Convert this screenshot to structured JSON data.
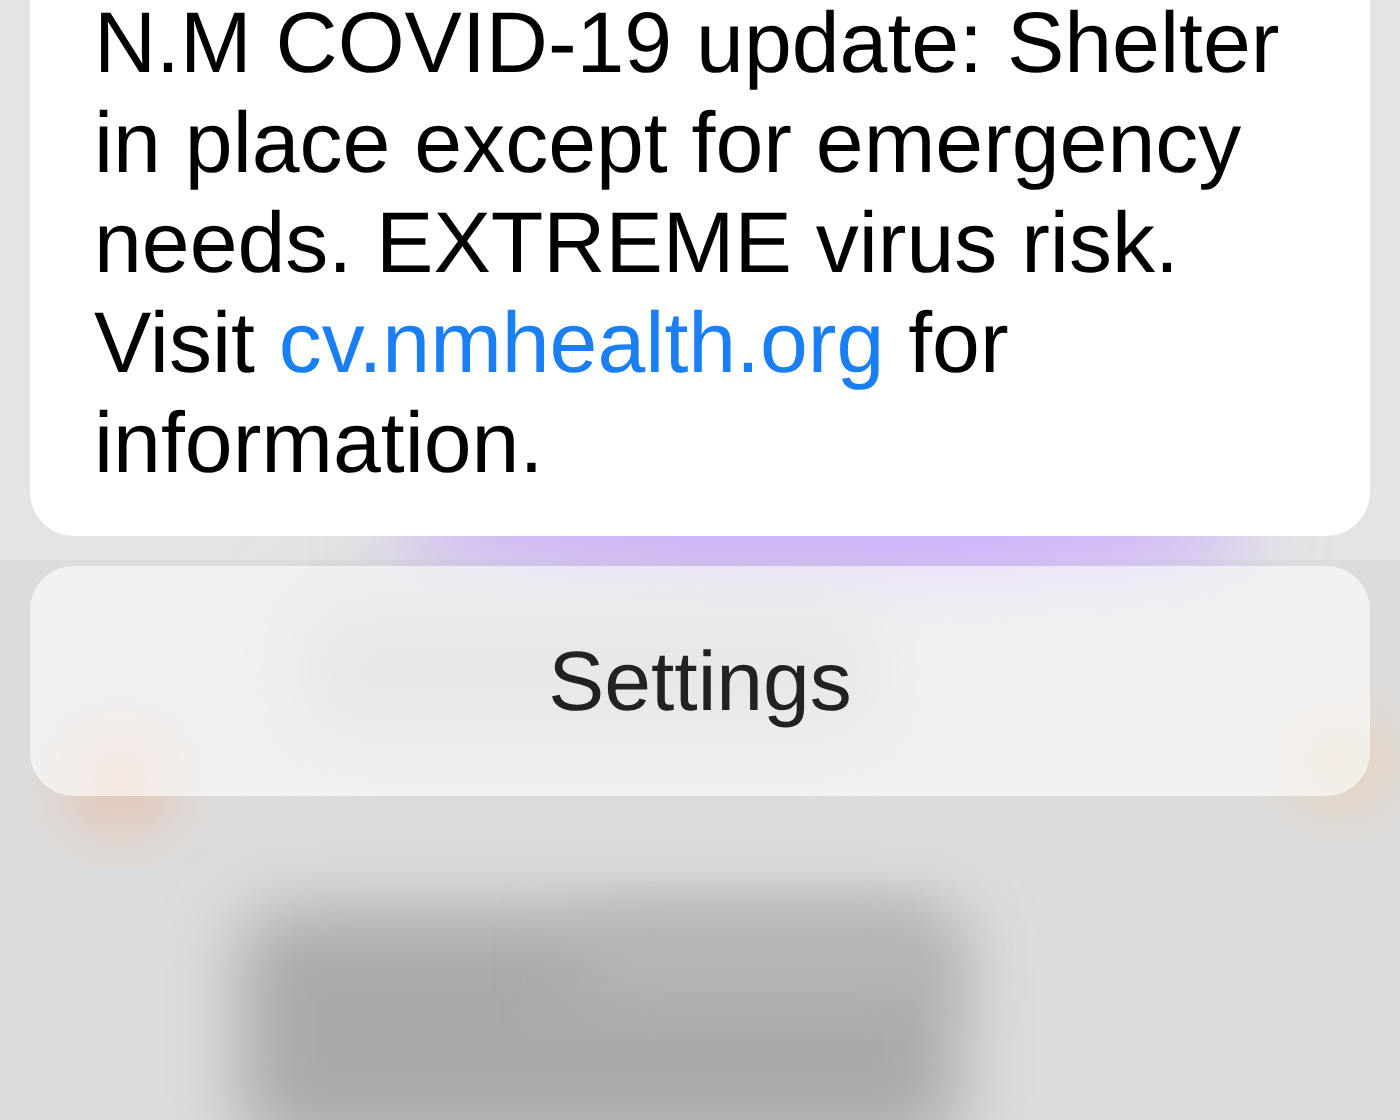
{
  "alert": {
    "message_before": "N.M COVID-19 update: Shelter in place except for emergency needs. EXTREME virus risk. Visit ",
    "link": "cv.nmhealth.org",
    "message_after": " for information."
  },
  "actions": [
    {
      "label": "Settings"
    }
  ]
}
